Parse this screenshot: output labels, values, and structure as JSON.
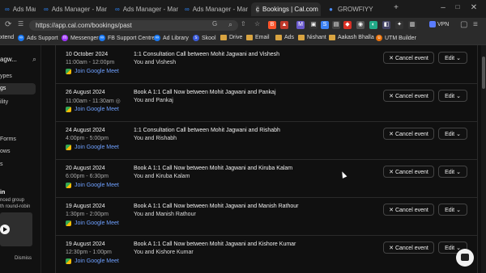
{
  "browser": {
    "tabs": [
      {
        "label": "Ads Manager - Manag",
        "icon": "meta-icon"
      },
      {
        "label": "Ads Manager - Manag",
        "icon": "meta-icon"
      },
      {
        "label": "Ads Manager - Manag",
        "icon": "meta-icon"
      },
      {
        "label": "Bookings | Cal.com",
        "icon": "cal-icon"
      },
      {
        "label": "GROWFIYY",
        "icon": "drop-icon"
      }
    ],
    "url": "https://app.cal.com/bookings/past",
    "bookmarks": {
      "first": "xtend",
      "items": [
        "Ads Support",
        "Messenger",
        "FB Support Centre",
        "Ad Library",
        "Skool",
        "Drive",
        "Email",
        "Ads",
        "Nishant",
        "Aakash Bhalla",
        "UTM Builder"
      ]
    },
    "vpn_label": "VPN"
  },
  "sidebar": {
    "username": "agw...",
    "items": [
      "ypes",
      "gs",
      "ility",
      "Forms",
      "ows",
      "s"
    ],
    "promo": {
      "title": "in",
      "lines": [
        "nced group",
        "th round-robin"
      ],
      "dismiss": "Dismiss"
    }
  },
  "bookings": [
    {
      "date": "10 October 2024",
      "time": "11:00am - 12:00pm",
      "title": "1:1 Consultation Call between Mohit Jagwani and Vishesh",
      "attendees": "You and Vishesh",
      "meet": "Join Google Meet",
      "cancel": "Cancel event",
      "edit": "Edit"
    },
    {
      "date": "26 August 2024",
      "time": "11:00am - 11:30am",
      "title": "Book A 1:1 Call Now between Mohit Jagwani and Pankaj",
      "attendees": "You and Pankaj",
      "meet": "Join Google Meet",
      "cancel": "Cancel event",
      "edit": "Edit"
    },
    {
      "date": "24 August 2024",
      "time": "4:00pm - 5:00pm",
      "title": "1:1 Consultation Call between Mohit Jagwani and Rishabh",
      "attendees": "You and Rishabh",
      "meet": "Join Google Meet",
      "cancel": "Cancel event",
      "edit": "Edit"
    },
    {
      "date": "20 August 2024",
      "time": "6:00pm - 6:30pm",
      "title": "Book A 1:1 Call Now between Mohit Jagwani and Kiruba Kalam",
      "attendees": "You and Kiruba Kalam",
      "meet": "Join Google Meet",
      "cancel": "Cancel event",
      "edit": "Edit"
    },
    {
      "date": "19 August 2024",
      "time": "1:30pm - 2:00pm",
      "title": "Book A 1:1 Call Now between Mohit Jagwani and Manish Rathour",
      "attendees": "You and Manish Rathour",
      "meet": "Join Google Meet",
      "cancel": "Cancel event",
      "edit": "Edit"
    },
    {
      "date": "19 August 2024",
      "time": "12:30pm - 1:00pm",
      "title": "Book A 1:1 Call Now between Mohit Jagwani and Kishore Kumar",
      "attendees": "You and Kishore Kumar",
      "meet": "Join Google Meet",
      "cancel": "Cancel event",
      "edit": "Edit"
    }
  ]
}
